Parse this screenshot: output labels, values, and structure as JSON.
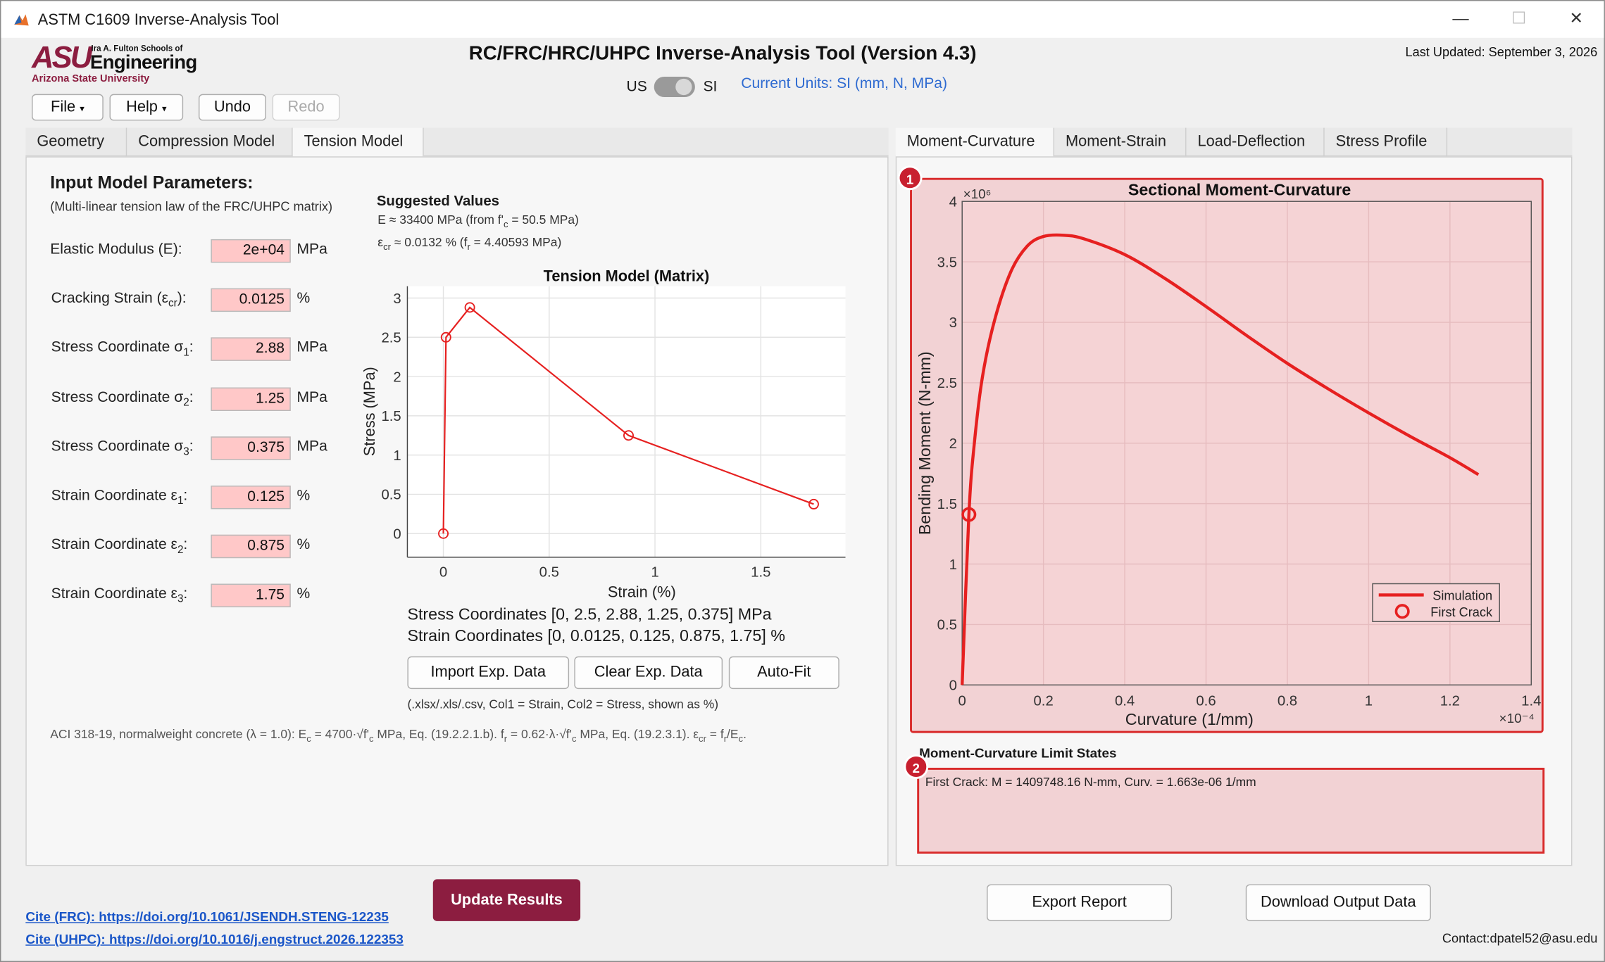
{
  "window": {
    "title": "ASTM C1609 Inverse-Analysis Tool",
    "minimize": "—",
    "maximize": "☐",
    "close": "✕"
  },
  "branding": {
    "logo_letters": "ASU",
    "school_line": "Ira A. Fulton Schools of",
    "school_name": "Engineering",
    "university": "Arizona State University"
  },
  "header": {
    "app_title": "RC/FRC/HRC/UHPC Inverse-Analysis Tool (Version 4.3)",
    "last_updated": "Last Updated: September 3, 2026",
    "unit_left": "US",
    "unit_right": "SI",
    "current_units": "Current Units: SI (mm, N, MPa)"
  },
  "toolbar": {
    "file": "File",
    "help": "Help",
    "undo": "Undo",
    "redo": "Redo",
    "caret": "▾"
  },
  "left_tabs": [
    "Geometry",
    "Compression Model",
    "Tension Model"
  ],
  "right_tabs": [
    "Moment-Curvature",
    "Moment-Strain",
    "Load-Deflection",
    "Stress Profile"
  ],
  "params": {
    "heading": "Input Model Parameters:",
    "subheading": "(Multi-linear tension law of the FRC/UHPC matrix)",
    "rows": [
      {
        "label": "Elastic Modulus (E):",
        "value": "2e+04",
        "unit": "MPa"
      },
      {
        "label": "Cracking Strain (ε",
        "sub": "cr",
        "after": "):",
        "value": "0.0125",
        "unit": "%"
      },
      {
        "label": "Stress Coordinate σ",
        "sub": "1",
        "after": ":",
        "value": "2.88",
        "unit": "MPa"
      },
      {
        "label": "Stress Coordinate σ",
        "sub": "2",
        "after": ":",
        "value": "1.25",
        "unit": "MPa"
      },
      {
        "label": "Stress Coordinate σ",
        "sub": "3",
        "after": ":",
        "value": "0.375",
        "unit": "MPa"
      },
      {
        "label": "Strain Coordinate ε",
        "sub": "1",
        "after": ":",
        "value": "0.125",
        "unit": "%"
      },
      {
        "label": "Strain Coordinate ε",
        "sub": "2",
        "after": ":",
        "value": "0.875",
        "unit": "%"
      },
      {
        "label": "Strain Coordinate ε",
        "sub": "3",
        "after": ":",
        "value": "1.75",
        "unit": "%"
      }
    ]
  },
  "suggested": {
    "title": "Suggested Values",
    "line1": "E ≈ 33400 MPa  (from f'c = 50.5 MPa)",
    "line2": "εcr ≈ 0.0132 %  (fr = 4.40593 MPa)"
  },
  "coords": {
    "stress": "Stress Coordinates [0, 2.5, 2.88, 1.25, 0.375] MPa",
    "strain": "Strain Coordinates [0, 0.0125, 0.125, 0.875, 1.75] %"
  },
  "exp_buttons": {
    "import": "Import Exp. Data",
    "clear": "Clear Exp. Data",
    "autofit": "Auto-Fit",
    "hint": "(.xlsx/.xls/.csv, Col1 = Strain, Col2 = Stress, shown as %)"
  },
  "aci_note": "ACI 318-19, normalweight concrete (λ = 1.0): Ec = 4700·√f'c MPa, Eq. (19.2.2.1.b). fr = 0.62·λ·√f'c MPa, Eq. (19.2.3.1). εcr = fr/Ec.",
  "limit_states": {
    "title": "Moment-Curvature Limit States",
    "text": "First Crack: M = 1409748.16 N-mm, Curv. = 1.663e-06 1/mm"
  },
  "badges": {
    "one": "1",
    "two": "2"
  },
  "footer": {
    "update": "Update Results",
    "export": "Export Report",
    "download": "Download Output Data",
    "cite_frc": "Cite (FRC): https://doi.org/10.1061/JSENDH.STENG-12235",
    "cite_uhpc": "Cite (UHPC): https://doi.org/10.1016/j.engstruct.2026.122353",
    "contact": "Contact:dpatel52@asu.edu"
  },
  "chart_data": [
    {
      "type": "line",
      "title": "Tension Model (Matrix)",
      "xlabel": "Strain (%)",
      "ylabel": "Stress (MPa)",
      "xlim": [
        -0.17,
        1.9
      ],
      "ylim": [
        -0.3,
        3.15
      ],
      "xticks": [
        0,
        0.5,
        1,
        1.5
      ],
      "yticks": [
        0,
        0.5,
        1,
        1.5,
        2,
        2.5,
        3
      ],
      "x": [
        0,
        0.0125,
        0.125,
        0.875,
        1.75
      ],
      "y": [
        0,
        2.5,
        2.88,
        1.25,
        0.375
      ],
      "markers": "circle",
      "grid": true,
      "color": "#e62020"
    },
    {
      "type": "line",
      "title": "Sectional Moment-Curvature",
      "xlabel": "Curvature (1/mm)",
      "ylabel": "Bending Moment (N-mm)",
      "x_multiplier": "×10⁻⁴",
      "y_multiplier": "×10⁶",
      "xlim": [
        0,
        1.4
      ],
      "ylim": [
        0,
        4
      ],
      "xticks": [
        0,
        0.2,
        0.4,
        0.6,
        0.8,
        1,
        1.2,
        1.4
      ],
      "yticks": [
        0,
        0.5,
        1,
        1.5,
        2,
        2.5,
        3,
        3.5,
        4
      ],
      "series": [
        {
          "name": "Simulation",
          "x": [
            0,
            0.0166,
            0.03,
            0.05,
            0.08,
            0.12,
            0.16,
            0.2,
            0.25,
            0.3,
            0.4,
            0.5,
            0.6,
            0.7,
            0.8,
            0.9,
            1.0,
            1.1,
            1.2,
            1.27
          ],
          "y": [
            0,
            1.41,
            2.0,
            2.55,
            3.02,
            3.42,
            3.63,
            3.71,
            3.72,
            3.69,
            3.56,
            3.36,
            3.13,
            2.89,
            2.66,
            2.45,
            2.25,
            2.06,
            1.88,
            1.74
          ]
        },
        {
          "name": "First Crack",
          "x": [
            0.0166
          ],
          "y": [
            1.41
          ]
        }
      ],
      "legend": "bottom-right",
      "grid": true,
      "color": "#e62020",
      "background": "#f5d3d5"
    }
  ]
}
